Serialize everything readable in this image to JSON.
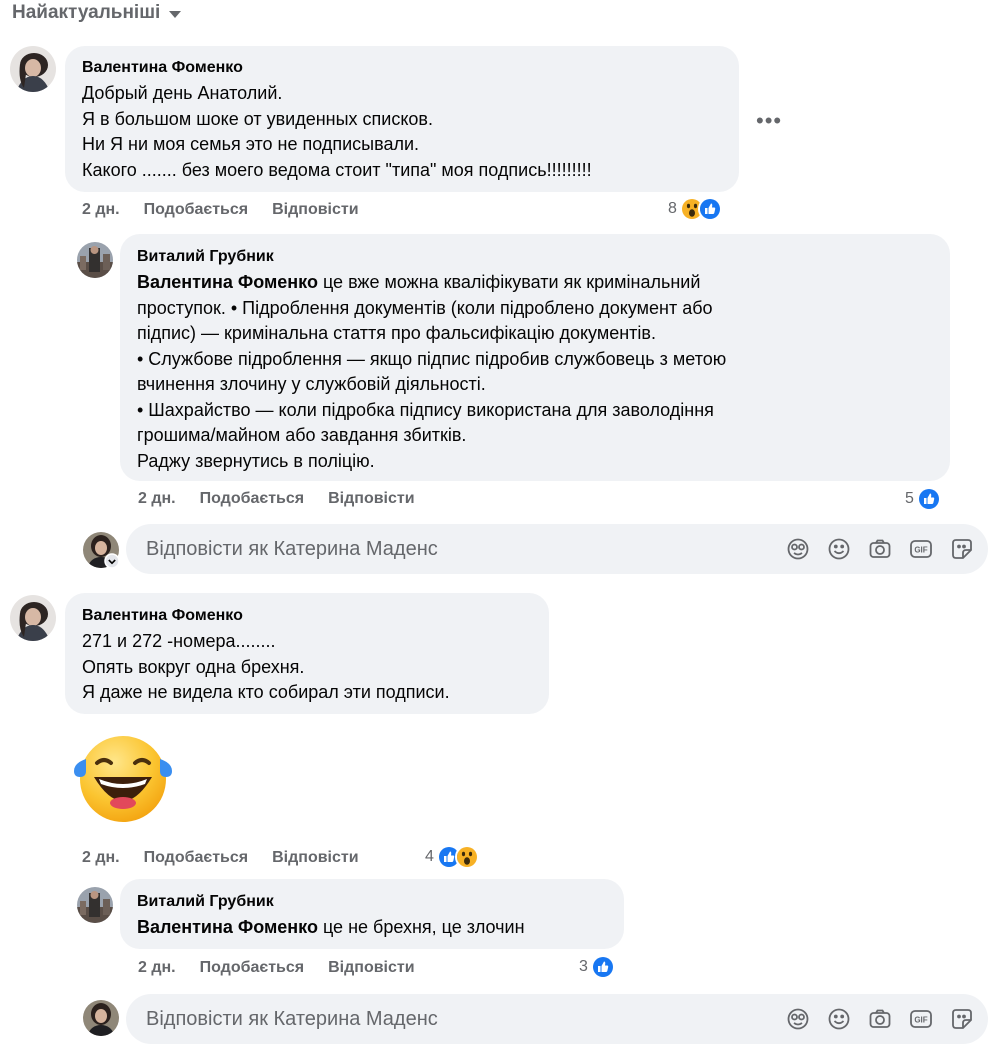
{
  "sort": {
    "label": "Найактуальніші"
  },
  "actions": {
    "like": "Подобається",
    "reply": "Відповісти"
  },
  "reply_placeholder": "Відповісти як Катерина Маденс",
  "comments": [
    {
      "author": "Валентина Фоменко",
      "text": "Добрый день Анатолий.\nЯ в большом шоке от увиденных списков.\nНи Я ни моя семья это не подписывали.\nКакого ....... без моего ведома стоит \"типа\" моя подпись!!!!!!!!!",
      "time": "2 дн.",
      "reactions_count": "8",
      "reactions": [
        "wow-icon",
        "like-icon"
      ],
      "replies": [
        {
          "author": "Виталий Грубник",
          "mention": "Валентина Фоменко",
          "text": " це вже можна кваліфікувати як кримінальний\nпроступок. • Підроблення документів (коли підроблено документ або\nпідпис) — кримінальна стаття про фальсифікацію документів.\n• Службове підроблення — якщо підпис підробив службовець з метою\nвчинення злочину у службовій діяльності.\n• Шахрайство — коли підробка підпису використана для заволодіння\nгрошима/майном або завдання збитків.\nРаджу звернутись в поліцію.",
          "time": "2 дн.",
          "reactions_count": "5",
          "reactions": [
            "like-icon"
          ]
        }
      ]
    },
    {
      "author": "Валентина Фоменко",
      "text": "271 и 272 -номера........\nОпять вокруг одна брехня.\nЯ даже не видела кто собирал эти подписи.",
      "sticker": "laughing-emoji",
      "time": "2 дн.",
      "reactions_count": "4",
      "reactions": [
        "like-icon",
        "wow-icon"
      ],
      "replies": [
        {
          "author": "Виталий Грубник",
          "mention": "Валентина Фоменко",
          "text": " це не брехня, це злочин",
          "time": "2 дн.",
          "reactions_count": "3",
          "reactions": [
            "like-icon"
          ]
        }
      ]
    }
  ],
  "colors": {
    "bubble": "#f0f2f5",
    "meta": "#65676b",
    "like": "#1877f2",
    "wow": "#f7b125"
  }
}
